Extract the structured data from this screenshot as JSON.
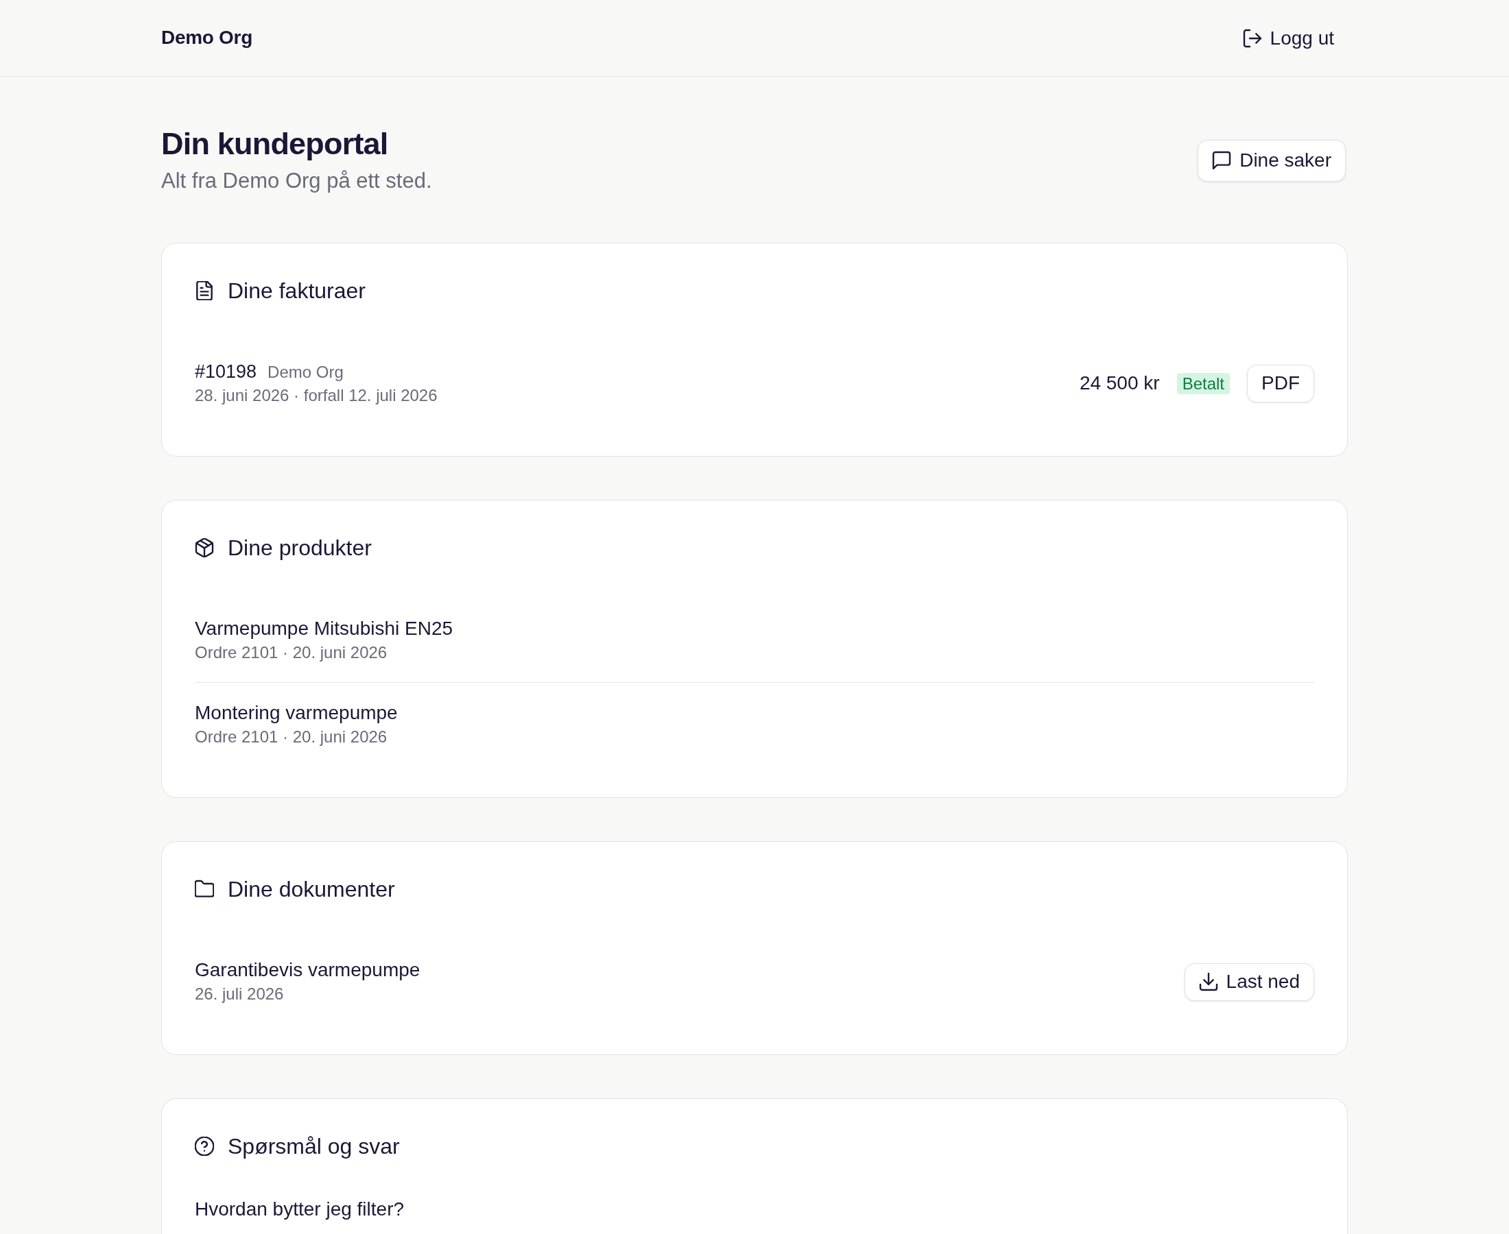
{
  "header": {
    "brand": "Demo Org",
    "logout_button": "Logg ut"
  },
  "hero": {
    "title": "Din kundeportal",
    "subtitle": "Alt fra Demo Org på ett sted.",
    "cases_button": "Dine saker"
  },
  "sections": [
    {
      "kind": "invoices",
      "title": "Dine fakturaer",
      "items": [
        {
          "number": "#10198",
          "customer": "Demo Org",
          "dates": "28. juni 2026 · forfall 12. juli 2026",
          "amount": "24 500 kr",
          "status": "Betalt",
          "button": "PDF"
        }
      ]
    },
    {
      "kind": "products",
      "title": "Dine produkter",
      "items": [
        {
          "name": "Varmepumpe Mitsubishi EN25",
          "details": "Ordre 2101 · 20. juni 2026"
        },
        {
          "name": "Montering varmepumpe",
          "details": "Ordre 2101 · 20. juni 2026"
        }
      ]
    },
    {
      "kind": "documents",
      "title": "Dine dokumenter",
      "items": [
        {
          "name": "Garantibevis varmepumpe",
          "date": "26. juli 2026",
          "button": "Last ned"
        }
      ]
    },
    {
      "kind": "faq",
      "title": "Spørsmål og svar",
      "items": [
        {
          "question": "Hvordan bytter jeg filter?"
        }
      ]
    }
  ]
}
